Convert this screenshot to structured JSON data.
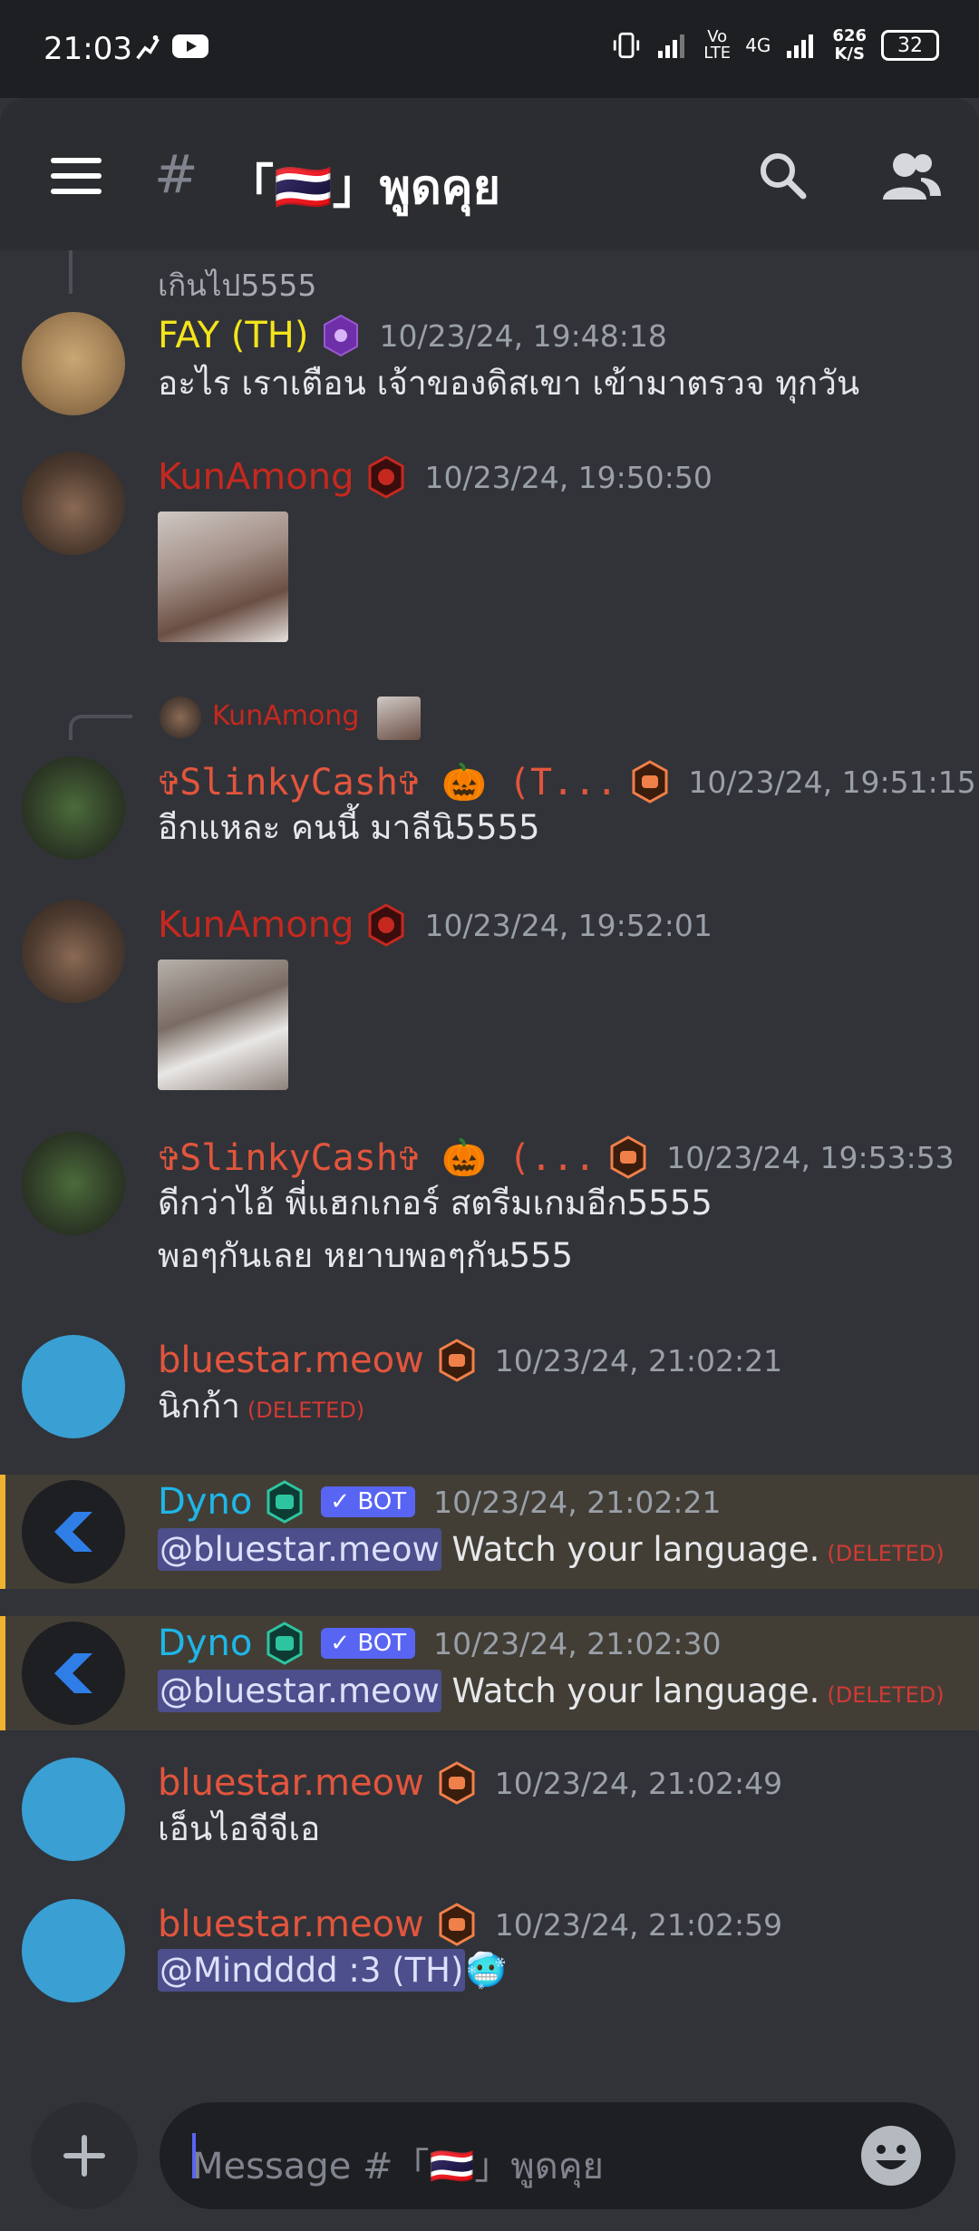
{
  "status_bar": {
    "time": "21:03",
    "net_speed": "626",
    "net_unit": "K/S",
    "battery": "32",
    "network": "4G"
  },
  "header": {
    "channel_title": "「🇹🇭」พูดคุย"
  },
  "previous_text": "เกินไป5555",
  "messages": [
    {
      "username": "FAY (TH)",
      "timestamp": "10/23/24, 19:48:18",
      "content": "อะไร เราเตือน เจ้าของดิสเขา เข้ามาตรวจ   ทุกวัน",
      "name_color": "#f4e41b"
    },
    {
      "username": "KunAmong",
      "timestamp": "10/23/24, 19:50:50",
      "name_color": "#c5281f"
    },
    {
      "reply_to": "KunAmong",
      "username": "✞SlinkyCash✞ 🎃 (T...",
      "timestamp": "10/23/24, 19:51:15",
      "content": "อีกแหละ คนนี้ มาลีนิ5555",
      "name_color": "#e2553d"
    },
    {
      "username": "KunAmong",
      "timestamp": "10/23/24, 19:52:01",
      "name_color": "#c5281f"
    },
    {
      "username": "✞SlinkyCash✞ 🎃 (...",
      "timestamp": "10/23/24, 19:53:53",
      "content_line1": "ดีกว่าไอ้ พี่แฮกเกอร์ สตรีมเกมอีก5555",
      "content_line2": "พอๆกันเลย หยาบพอๆกัน555",
      "name_color": "#e2553d"
    },
    {
      "username": "bluestar.meow",
      "timestamp": "10/23/24, 21:02:21",
      "content": "นิกก้า",
      "deleted": "(DELETED)",
      "name_color": "#e2553d"
    },
    {
      "username": "Dyno",
      "bot_label": "✓ BOT",
      "timestamp": "10/23/24, 21:02:21",
      "mention": "@bluestar.meow",
      "content": " Watch your language.",
      "deleted": "(DELETED)",
      "name_color": "#1fb6e8"
    },
    {
      "username": "Dyno",
      "bot_label": "✓ BOT",
      "timestamp": "10/23/24, 21:02:30",
      "mention": "@bluestar.meow",
      "content": " Watch your language.",
      "deleted": "(DELETED)",
      "name_color": "#1fb6e8"
    },
    {
      "username": "bluestar.meow",
      "timestamp": "10/23/24, 21:02:49",
      "content": "เอ็นไอจีจีเอ",
      "name_color": "#e2553d"
    },
    {
      "username": "bluestar.meow",
      "timestamp": "10/23/24, 21:02:59",
      "mention": "@Mindddd :3 (TH)",
      "emoji": "🥶",
      "name_color": "#e2553d"
    }
  ],
  "composer": {
    "placeholder": "Message #「🇹🇭」พูดคุย"
  },
  "colors": {
    "background": "#313338",
    "header": "#2b2d31",
    "accent": "#5865f2",
    "highlight": "#f0b232"
  }
}
